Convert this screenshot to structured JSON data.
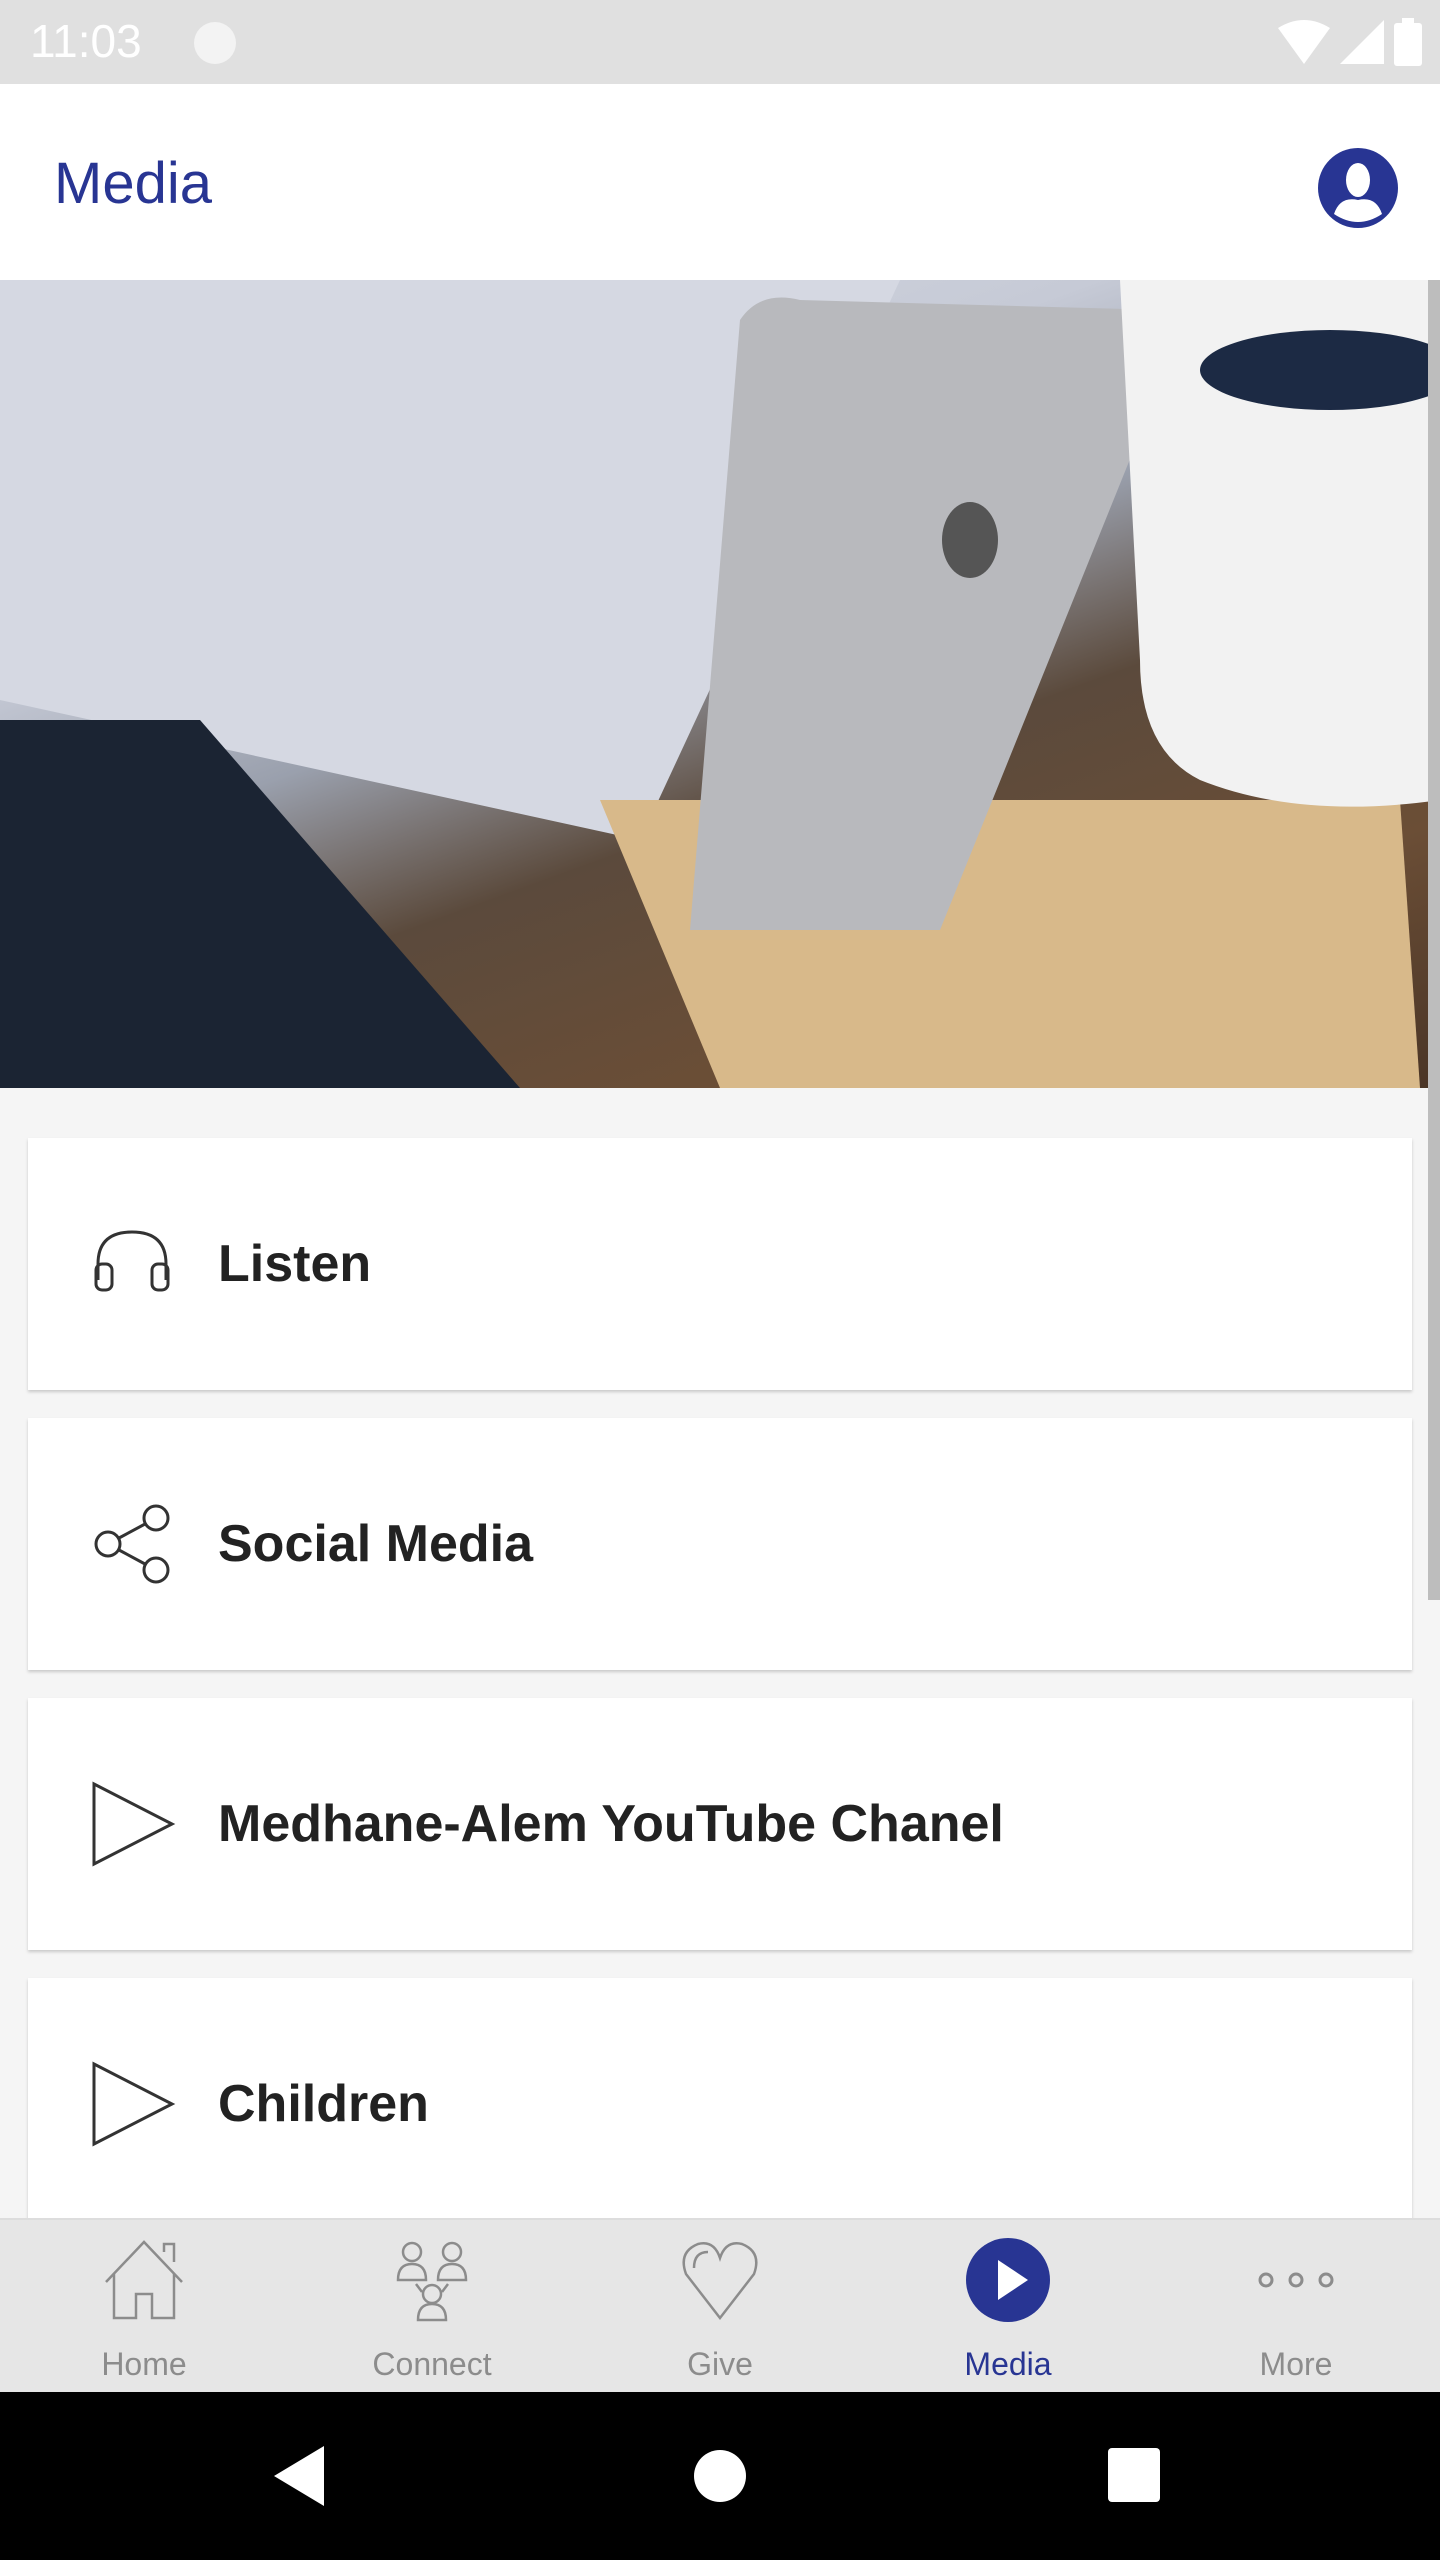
{
  "status_bar": {
    "time": "11:03"
  },
  "header": {
    "title": "Media",
    "avatar_icon": "account-circle-icon"
  },
  "hero": {
    "image": "phone-on-wooden-stand-with-notebook-and-coffee"
  },
  "menu": [
    {
      "label": "Listen",
      "icon": "headphones-icon"
    },
    {
      "label": "Social Media",
      "icon": "share-icon"
    },
    {
      "label": "Medhane-Alem YouTube Chanel",
      "icon": "play-icon"
    },
    {
      "label": "Children",
      "icon": "play-icon"
    }
  ],
  "bottom_nav": [
    {
      "label": "Home",
      "icon": "home-icon"
    },
    {
      "label": "Connect",
      "icon": "people-icon"
    },
    {
      "label": "Give",
      "icon": "heart-icon"
    },
    {
      "label": "Media",
      "icon": "play-circle-icon",
      "active": true
    },
    {
      "label": "More",
      "icon": "more-icon"
    }
  ],
  "colors": {
    "accent": "#283593",
    "inactive": "#8c8c8c"
  }
}
